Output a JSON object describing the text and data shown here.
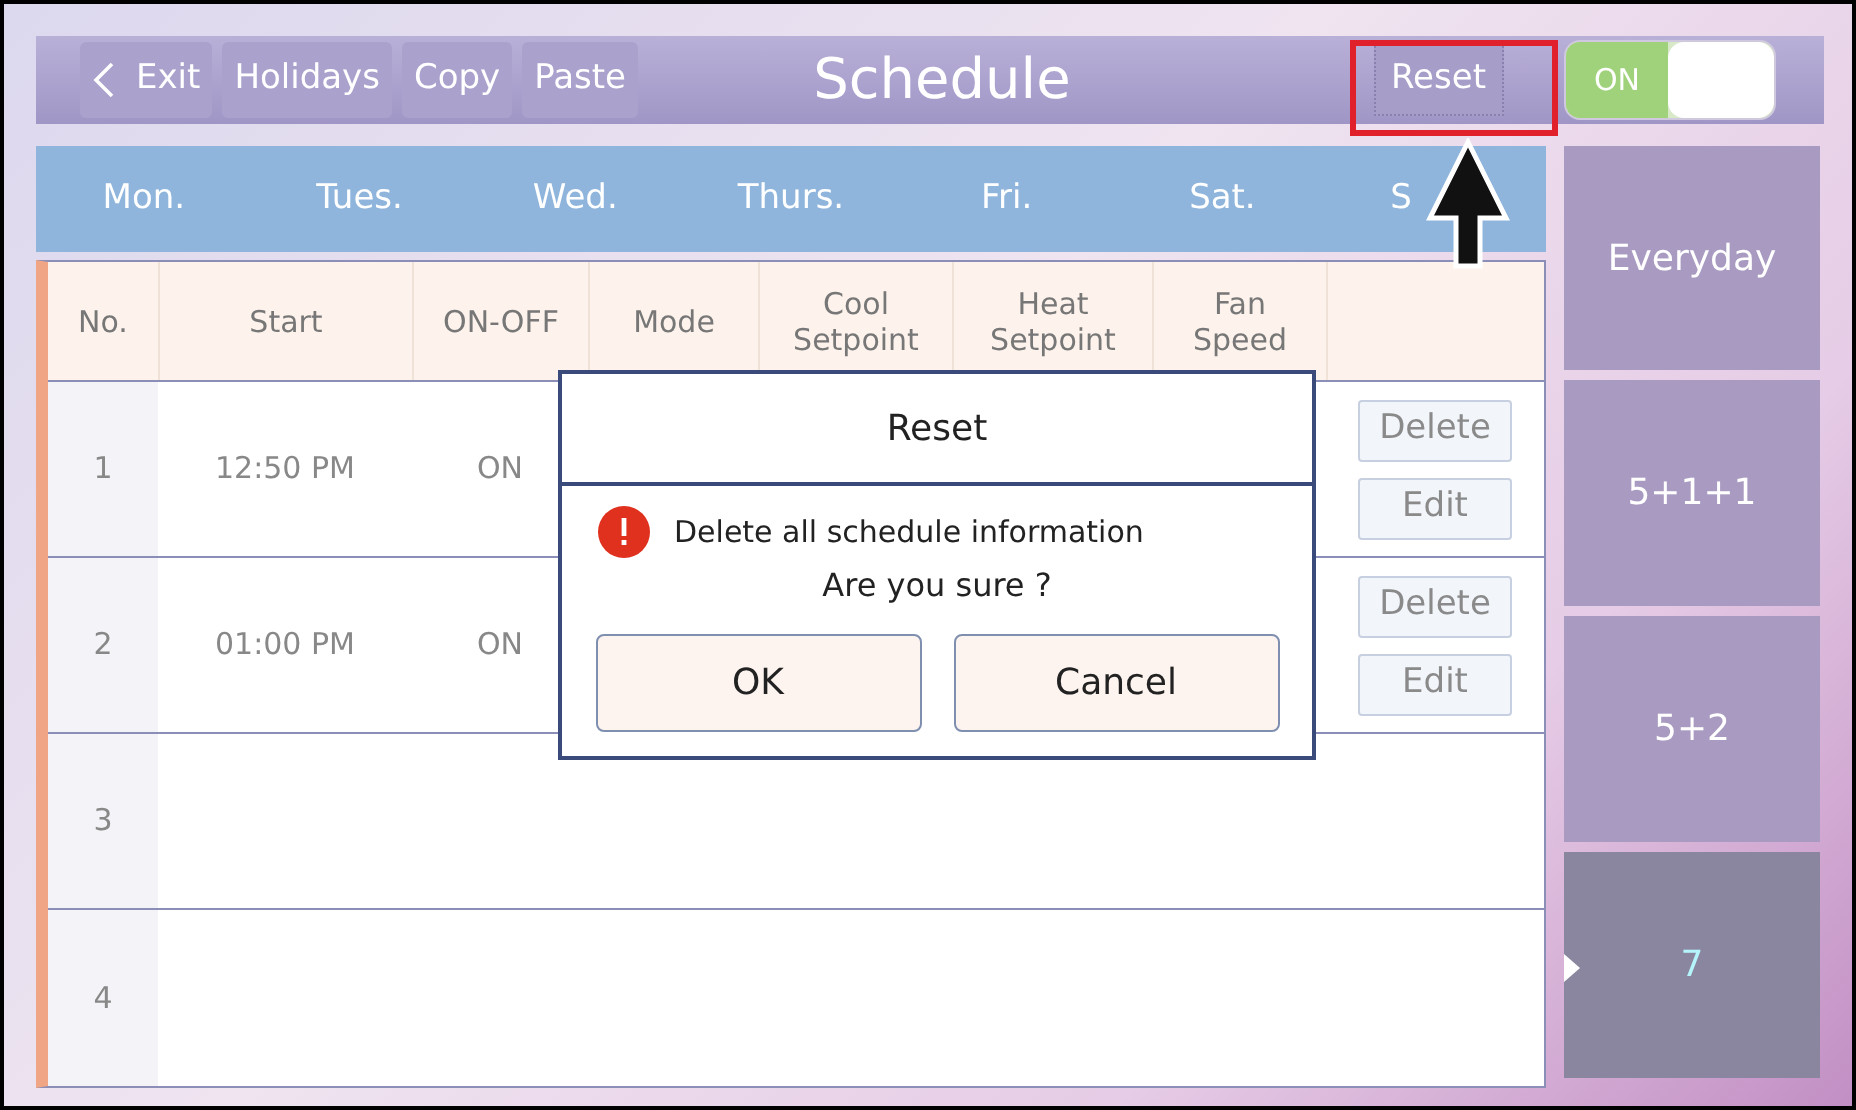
{
  "top_bar": {
    "buttons": [
      {
        "label": "Exit",
        "kind": "back"
      },
      {
        "label": "Holidays",
        "kind": "plain"
      },
      {
        "label": "Copy",
        "kind": "plain"
      },
      {
        "label": "Paste",
        "kind": "plain"
      }
    ],
    "title": "Schedule",
    "reset_button": "Reset",
    "power_toggle": {
      "label": "ON",
      "on": true
    }
  },
  "days": [
    "Mon.",
    "Tues.",
    "Wed.",
    "Thurs.",
    "Fri.",
    "Sat.",
    "S"
  ],
  "table": {
    "columns": [
      "No.",
      "Start",
      "ON-OFF",
      "Mode",
      "Cool Setpoint",
      "Heat Setpoint",
      "Fan Speed"
    ],
    "rows": [
      {
        "no": "1",
        "start": "12:50 PM",
        "on_off": "ON",
        "actions": [
          "Delete",
          "Edit"
        ]
      },
      {
        "no": "2",
        "start": "01:00 PM",
        "on_off": "ON",
        "actions": [
          "Delete",
          "Edit"
        ]
      },
      {
        "no": "3"
      },
      {
        "no": "4"
      }
    ]
  },
  "modes": [
    {
      "label": "Everyday",
      "selected": false
    },
    {
      "label": "5+1+1",
      "selected": false
    },
    {
      "label": "5+2",
      "selected": false
    },
    {
      "label": "7",
      "selected": true
    }
  ],
  "dialog": {
    "title": "Reset",
    "message": "Delete all schedule information",
    "question": "Are you sure ?",
    "buttons": [
      "OK",
      "Cancel"
    ]
  }
}
